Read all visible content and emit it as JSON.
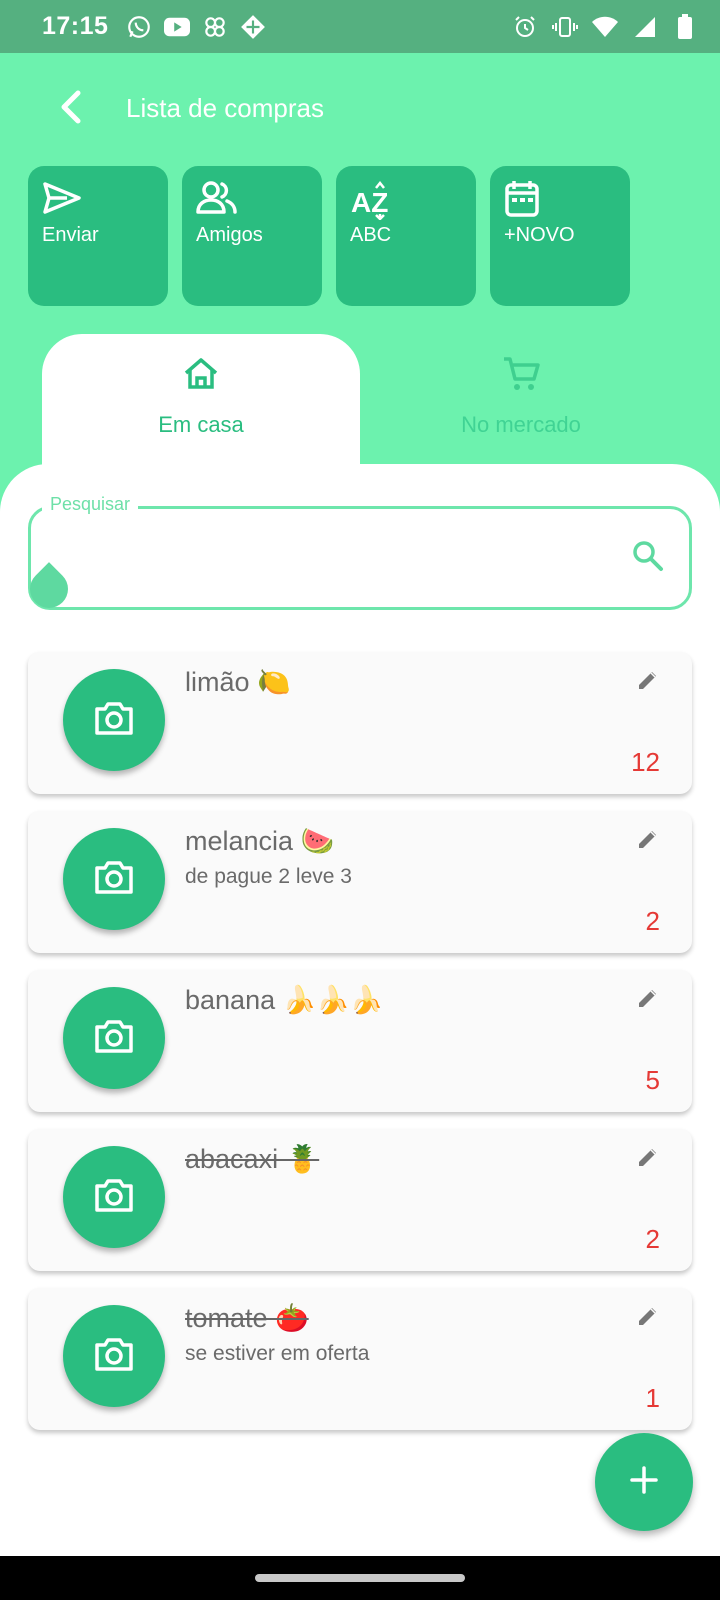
{
  "status_bar": {
    "time": "17:15",
    "left_icons": [
      "whatsapp-icon",
      "youtube-icon",
      "pinwheel-icon",
      "diamond-app-icon"
    ],
    "right_icons": [
      "alarm-icon",
      "vibrate-icon",
      "wifi-icon",
      "signal-icon",
      "battery-icon"
    ]
  },
  "app_bar": {
    "title": "Lista de compras"
  },
  "actions": [
    {
      "label": "Enviar",
      "icon": "send-icon"
    },
    {
      "label": "Amigos",
      "icon": "people-icon"
    },
    {
      "label": "ABC",
      "icon": "sort-az-icon"
    },
    {
      "label": "+NOVO",
      "icon": "calendar-icon"
    }
  ],
  "tabs": [
    {
      "label": "Em casa",
      "icon": "home-icon",
      "active": true
    },
    {
      "label": "No mercado",
      "icon": "cart-icon",
      "active": false
    }
  ],
  "search": {
    "label": "Pesquisar",
    "value": ""
  },
  "items": [
    {
      "name": "limão 🍋",
      "note": "",
      "qty": "12",
      "done": false
    },
    {
      "name": "melancia 🍉",
      "note": "de pague 2 leve 3",
      "qty": "2",
      "done": false
    },
    {
      "name": "banana 🍌🍌🍌",
      "note": "",
      "qty": "5",
      "done": false
    },
    {
      "name": "abacaxi 🍍",
      "note": "",
      "qty": "2",
      "done": true
    },
    {
      "name": "tomate 🍅",
      "note": "se estiver em oferta",
      "qty": "1",
      "done": true
    }
  ],
  "colors": {
    "primary": "#2abd80",
    "background": "#6cf2ae",
    "status_bar": "#55b080",
    "quantity": "#e53935"
  }
}
